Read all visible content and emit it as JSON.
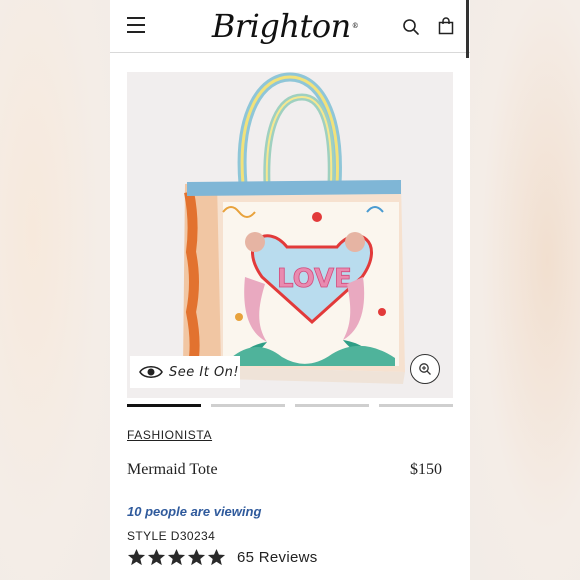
{
  "header": {
    "brand": "Brighton",
    "brand_mark": "®",
    "menu_icon": "hamburger-menu-icon",
    "search_icon": "search-icon",
    "bag_icon": "shopping-bag-icon"
  },
  "gallery": {
    "image_subject": "tote-bag-product-photo",
    "see_it_on_label": "See It On!",
    "see_it_on_icon": "eye-icon",
    "zoom_icon": "zoom-in-icon",
    "slide_count": 4,
    "active_slide": 1
  },
  "product": {
    "collection": "FASHIONISTA",
    "name": "Mermaid Tote",
    "price": "$150",
    "viewing_notice": "10 people are viewing",
    "style": "STYLE D30234",
    "rating": 5,
    "reviews_label": "65 Reviews"
  },
  "colors": {
    "accent_link": "#2f5a9c",
    "text": "#222222",
    "active_indicator": "#111111",
    "inactive_indicator": "#cfcfcf"
  }
}
